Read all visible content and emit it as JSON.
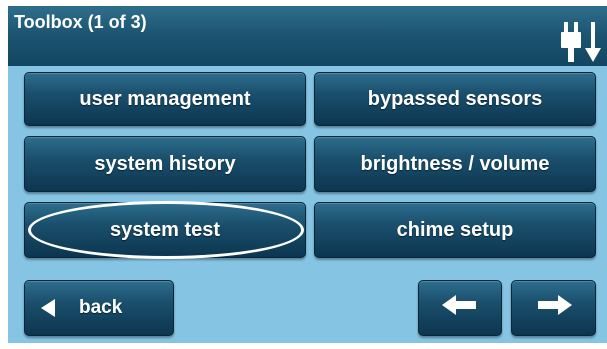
{
  "header": {
    "title": "Toolbox (1 of 3)",
    "power_icon": "plug-power-down-icon"
  },
  "menu": {
    "user_management": "user management",
    "bypassed_sensors": "bypassed sensors",
    "system_history": "system history",
    "brightness_volume": "brightness / volume",
    "system_test": "system test",
    "chime_setup": "chime setup"
  },
  "nav": {
    "back_label": "back",
    "back_icon": "triangle-left-icon",
    "prev_icon": "arrow-left-icon",
    "next_icon": "arrow-right-icon"
  },
  "colors": {
    "header_bg": "#1d5672",
    "panel_bg": "#86c4e4",
    "button_bg": "#1a4f6c",
    "text": "#ffffff"
  }
}
